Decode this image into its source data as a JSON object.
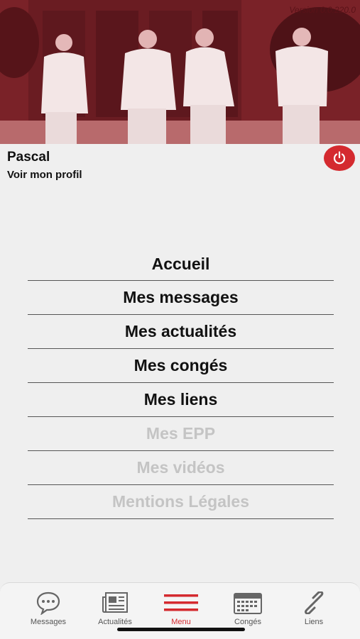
{
  "header": {
    "version": "Version 0.0.220.0"
  },
  "profile": {
    "name": "Pascal",
    "link": "Voir mon profil"
  },
  "menu": {
    "items": [
      {
        "label": "Accueil",
        "enabled": true
      },
      {
        "label": "Mes messages",
        "enabled": true
      },
      {
        "label": "Mes actualités",
        "enabled": true
      },
      {
        "label": "Mes congés",
        "enabled": true
      },
      {
        "label": "Mes liens",
        "enabled": true
      },
      {
        "label": "Mes EPP",
        "enabled": false
      },
      {
        "label": "Mes vidéos",
        "enabled": false
      },
      {
        "label": "Mentions Légales",
        "enabled": false
      }
    ]
  },
  "tabbar": {
    "tabs": [
      {
        "label": "Messages",
        "icon": "chat-bubble-icon",
        "active": false
      },
      {
        "label": "Actualités",
        "icon": "newspaper-icon",
        "active": false
      },
      {
        "label": "Menu",
        "icon": "hamburger-menu-icon",
        "active": true
      },
      {
        "label": "Congés",
        "icon": "calendar-icon",
        "active": false
      },
      {
        "label": "Liens",
        "icon": "link-icon",
        "active": false
      }
    ]
  },
  "colors": {
    "accent": "#d42a2f",
    "hero_tint": "#8a2a30",
    "disabled_text": "#c4c4c4"
  }
}
